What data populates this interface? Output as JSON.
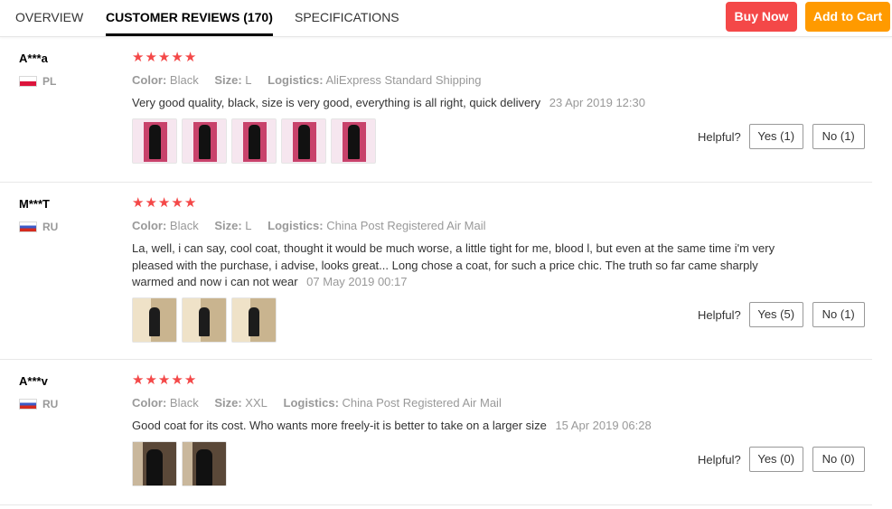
{
  "tabs": [
    {
      "label": "OVERVIEW"
    },
    {
      "label": "CUSTOMER REVIEWS (170)"
    },
    {
      "label": "SPECIFICATIONS"
    }
  ],
  "actions": {
    "buy_now": "Buy Now",
    "add_to_cart": "Add to Cart"
  },
  "colors": {
    "buy_now": "#f44848",
    "add_to_cart": "#ff9a00",
    "stars": "#f44848"
  },
  "labels": {
    "color": "Color:",
    "size": "Size:",
    "logistics": "Logistics:",
    "helpful": "Helpful?"
  },
  "reviews": [
    {
      "user": "A***a",
      "country": "PL",
      "rating": 5,
      "color": "Black",
      "size": "L",
      "logistics": "AliExpress Standard Shipping",
      "text": "Very good quality, black, size is very good, everything is all right, quick delivery",
      "date": "23 Apr 2019 12:30",
      "photos": 5,
      "yes": "Yes (1)",
      "no": "No (1)"
    },
    {
      "user": "M***T",
      "country": "RU",
      "rating": 5,
      "color": "Black",
      "size": "L",
      "logistics": "China Post Registered Air Mail",
      "text": "La, well, i can say, cool coat, thought it would be much worse, a little tight for me, blood l, but even at the same time i'm very pleased with the purchase, i advise, looks great... Long chose a coat, for such a price chic. The truth so far came sharply warmed and now i can not wear",
      "date": "07 May 2019 00:17",
      "photos": 3,
      "yes": "Yes (5)",
      "no": "No (1)"
    },
    {
      "user": "A***v",
      "country": "RU",
      "rating": 5,
      "color": "Black",
      "size": "XXL",
      "logistics": "China Post Registered Air Mail",
      "text": "Good coat for its cost. Who wants more freely-it is better to take on a larger size",
      "date": "15 Apr 2019 06:28",
      "photos": 2,
      "yes": "Yes (0)",
      "no": "No (0)"
    }
  ]
}
